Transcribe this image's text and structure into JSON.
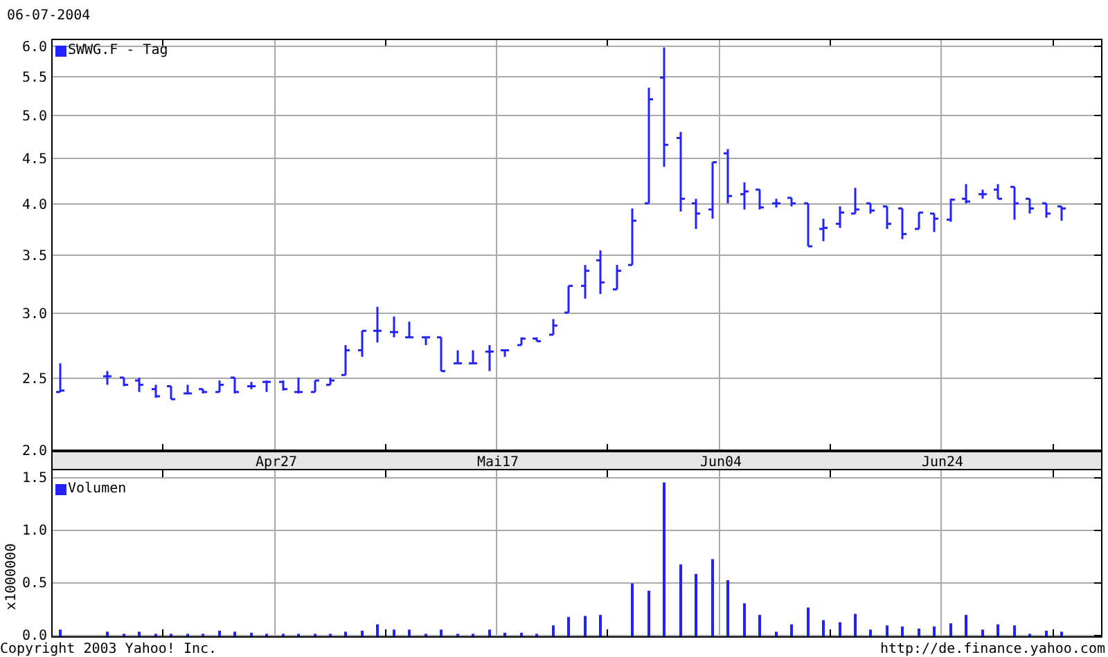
{
  "date": "06-07-2004",
  "price_chart": {
    "legend": "SWWG.F - Tag",
    "y_labels": [
      "6.0",
      "5.5",
      "5.0",
      "4.5",
      "4.0",
      "3.5",
      "3.0",
      "2.5",
      "2.0"
    ],
    "x_labels": [
      "Apr27",
      "Mai17",
      "Jun04",
      "Jun24"
    ]
  },
  "volume_chart": {
    "chart_data": {
      "type": "bar",
      "ylabel": "x1000000",
      "grid": true,
      "ylim": [
        0,
        1.5
      ],
      "categories": [
        null,
        null,
        null,
        null,
        null,
        null,
        null,
        null,
        null,
        null,
        null,
        null,
        null,
        null,
        null,
        null,
        null,
        null,
        null,
        null,
        null,
        null,
        null,
        null,
        null,
        null,
        null,
        null,
        null,
        null,
        null,
        null,
        null,
        null,
        null,
        null,
        null,
        null,
        null,
        null,
        null,
        null,
        null,
        null,
        null,
        null,
        null,
        null,
        null,
        null,
        null,
        null,
        null,
        null,
        null,
        null,
        null,
        null,
        null,
        null,
        null,
        null,
        null,
        null,
        null,
        null
      ],
      "yticks": [
        {
          "value": 0,
          "label": "0.0"
        },
        {
          "value": 0.5,
          "label": "0.5"
        },
        {
          "value": 1,
          "label": "1.0"
        },
        {
          "value": 1.5,
          "label": "1.5"
        }
      ],
      "series": [
        {
          "name": "Volumen",
          "color": "#2222ff",
          "values": [
            0.05,
            null,
            null,
            0.03,
            0.01,
            0.03,
            0.01,
            0.01,
            0.01,
            0.01,
            0.04,
            0.03,
            0.02,
            0.01,
            0.01,
            0.01,
            0.01,
            0.01,
            0.03,
            0.04,
            0.1,
            0.05,
            0.05,
            0.01,
            0.05,
            0.01,
            0.01,
            0.05,
            0.02,
            0.02,
            0.01,
            0.09,
            0.17,
            0.18,
            0.19,
            null,
            0.49,
            0.42,
            1.45,
            0.67,
            0.58,
            0.72,
            0.52,
            0.3,
            0.19,
            0.03,
            0.1,
            0.26,
            0.14,
            0.12,
            0.2,
            0.05,
            0.09,
            0.08,
            0.06,
            0.08,
            0.11,
            0.19,
            0.05,
            0.1,
            0.09,
            0.01,
            0.04,
            0.03,
            null,
            null
          ]
        }
      ]
    }
  },
  "footer": {
    "copyright": "Copyright 2003 Yahoo! Inc.",
    "url": "http://de.finance.yahoo.com"
  }
}
